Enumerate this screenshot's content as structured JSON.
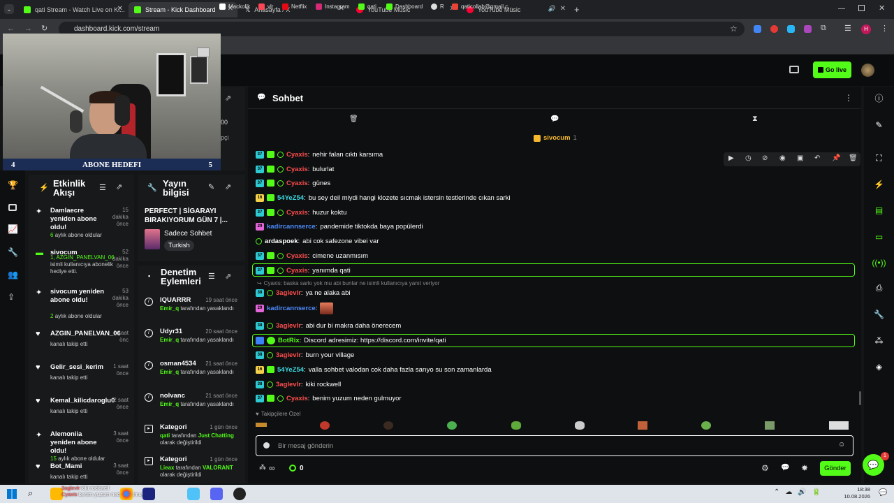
{
  "browser": {
    "tabs": [
      {
        "title": "qati Stream - Watch Live on Ki...",
        "color": "#53fc18"
      },
      {
        "title": "Stream - Kick Dashboard",
        "color": "#53fc18"
      },
      {
        "title": "Anasayfa / X",
        "color": "#ffffff"
      },
      {
        "title": "YouTube Music",
        "color": "#ff0033"
      },
      {
        "title": "YouTube Music",
        "color": "#ff0033"
      }
    ],
    "url": "dashboard.kick.com/stream",
    "bookmarks": [
      {
        "label": "Mackolik",
        "color": "#ffffff"
      },
      {
        "label": "vlr",
        "color": "#ff4655"
      },
      {
        "label": "Netflix",
        "color": "#e50914"
      },
      {
        "label": "Instagram",
        "color": "#d62976"
      },
      {
        "label": "qati",
        "color": "#53fc18"
      },
      {
        "label": "Dashboard",
        "color": "#53fc18"
      },
      {
        "label": "R",
        "color": "#ffffff"
      },
      {
        "label": "qaticollab@gmail.c...",
        "color": "#ea4335"
      }
    ],
    "profile_initial": "H"
  },
  "header": {
    "go_live": "Go live"
  },
  "overlay": {
    "abone_left": "4",
    "abone_title": "ABONE HEDEFI",
    "abone_right": "5"
  },
  "partial": {
    "text1": "00",
    "text2": "pçi"
  },
  "activity": {
    "title1": "Etkinlik",
    "title2": "Akışı",
    "items": [
      {
        "name": "Damlaecre yeniden abone oldu!",
        "time": "15 dakika önce",
        "detail_num": "6",
        "detail": "aylık abone oldular",
        "icon": "sparkle"
      },
      {
        "name": "sivocum",
        "time": "52 dakika önce",
        "detail_num": "1, AZGIN_PANELVAN_06",
        "detail": "isimli kullanıcıya abonelik hediye etti.",
        "icon": "gift"
      },
      {
        "name": "sivocum yeniden abone oldu!",
        "time": "53 dakika önce",
        "detail_num": "2",
        "detail": "aylık abone oldular",
        "icon": "sparkle"
      },
      {
        "name": "AZGIN_PANELVAN_06",
        "time": "1 saat önc",
        "detail_num": "",
        "detail": "kanalı takip etti",
        "icon": "heart"
      },
      {
        "name": "Gelir_sesi_kerim",
        "time": "1 saat önce",
        "detail_num": "",
        "detail": "kanalı takip etti",
        "icon": "heart"
      },
      {
        "name": "Kemal_kilicdaroglu0",
        "time": "2 saat önce",
        "detail_num": "",
        "detail": "kanalı takip etti",
        "icon": "heart"
      },
      {
        "name": "Alemoniia yeniden abone oldu!",
        "time": "3 saat önce",
        "detail_num": "15",
        "detail": "aylık abone oldular",
        "icon": "sparkle"
      },
      {
        "name": "Bot_Mami",
        "time": "3 saat önce",
        "detail_num": "",
        "detail": "kanalı takip etti",
        "icon": "heart"
      }
    ]
  },
  "streaminfo": {
    "title1": "Yayın",
    "title2": "bilgisi",
    "stream_title": "PERFECT | SİGARAYI BIRAKIYORUM GÜN 7 |...",
    "category": "Sadece Sohbet",
    "language": "Turkish"
  },
  "moderation": {
    "title1": "Denetim",
    "title2": "Eylemleri",
    "items": [
      {
        "name": "IQUARRR",
        "time": "19 saat önce",
        "by": "Emir_q",
        "action": "tarafından yasaklandı",
        "icon": "ban"
      },
      {
        "name": "Udyr31",
        "time": "20 saat önce",
        "by": "Emir_q",
        "action": "tarafından yasaklandı",
        "icon": "ban"
      },
      {
        "name": "osman4534",
        "time": "21 saat önce",
        "by": "Emir_q",
        "action": "tarafından yasaklandı",
        "icon": "ban"
      },
      {
        "name": "nolvanc",
        "time": "21 saat önce",
        "by": "Emir_q",
        "action": "tarafından yasaklandı",
        "icon": "ban"
      },
      {
        "name": "Kategori",
        "time": "1 gün önce",
        "by": "qati",
        "action": "tarafından",
        "target": "Just Chatting",
        "suffix": "olarak değiştirildi",
        "icon": "cat"
      },
      {
        "name": "Kategori",
        "time": "1 gün önce",
        "by": "Lieax",
        "action": "tarafından",
        "target": "VALORANT",
        "suffix": "olarak değiştirildi",
        "icon": "cat"
      }
    ]
  },
  "chat": {
    "title": "Sohbet",
    "pinned_user": "sivocum",
    "pinned_count": "1",
    "messages": [
      {
        "badge": "37",
        "sub": true,
        "ring": true,
        "user": "Cyaxis",
        "ucolor": "u-red",
        "text": "nehir falan cıktı karsıma"
      },
      {
        "badge": "37",
        "sub": true,
        "ring": true,
        "user": "Cyaxis",
        "ucolor": "u-red",
        "text": "bulurlat"
      },
      {
        "badge": "37",
        "sub": true,
        "ring": true,
        "user": "Cyaxis",
        "ucolor": "u-red",
        "text": "günes"
      },
      {
        "badge": "16",
        "sub": true,
        "ring": false,
        "user": "54YeZ54",
        "ucolor": "u-cyan",
        "text": "bu sey deil miydi hangi klozete sıcmak istersin testlerinde cıkan sarki"
      },
      {
        "badge": "37",
        "sub": true,
        "ring": true,
        "user": "Cyaxis",
        "ucolor": "u-red",
        "text": "huzur koktu"
      },
      {
        "badge": "29",
        "sub": false,
        "ring": false,
        "user": "kadircannserce",
        "ucolor": "u-blue",
        "text": "pandemide tiktokda baya popülerdi"
      },
      {
        "badge": "",
        "sub": false,
        "ring": true,
        "user": "ardaspoek",
        "ucolor": "u-white",
        "text": "abi cok safezone vibei var"
      },
      {
        "badge": "37",
        "sub": true,
        "ring": true,
        "user": "Cyaxis",
        "ucolor": "u-red",
        "text": "cimene uzanmısım"
      },
      {
        "badge": "37",
        "sub": true,
        "ring": true,
        "user": "Cyaxis",
        "ucolor": "u-red",
        "text": "yanımda qati"
      },
      {
        "badge": "38",
        "sub": false,
        "ring": true,
        "user": "3aglevlr",
        "ucolor": "u-red",
        "text": "ya ne alaka abi"
      },
      {
        "badge": "29",
        "sub": false,
        "ring": false,
        "user": "kadircannserce",
        "ucolor": "u-blue",
        "text": ""
      },
      {
        "badge": "38",
        "sub": false,
        "ring": true,
        "user": "3aglevlr",
        "ucolor": "u-red",
        "text": "abi dur bi makra daha önerecem"
      },
      {
        "badge": "",
        "sub": false,
        "ring": false,
        "user": "BotRix",
        "ucolor": "u-green",
        "text": "Discord adresimiz: https://discord.com/invite/qati"
      },
      {
        "badge": "38",
        "sub": false,
        "ring": true,
        "user": "3aglevlr",
        "ucolor": "u-red",
        "text": "burn your village"
      },
      {
        "badge": "16",
        "sub": true,
        "ring": false,
        "user": "54YeZ54",
        "ucolor": "u-cyan",
        "text": "valla sohbet valodan cok daha fazla sarıyo su son zamanlarda"
      },
      {
        "badge": "38",
        "sub": false,
        "ring": true,
        "user": "3aglevlr",
        "ucolor": "u-red",
        "text": "kiki rockwell"
      },
      {
        "badge": "37",
        "sub": true,
        "ring": true,
        "user": "Cyaxis",
        "ucolor": "u-red",
        "text": "benim yuzum neden gulmuyor"
      }
    ],
    "reply_note": "Cyaxis: baska sarkı yok mu abi bunlar ne isimli kullanıcıya yanıt veriyor",
    "followers_only": "Takipçilere Özel",
    "input_placeholder": "Bir mesaj gönderin",
    "infinite": "∞",
    "points": "0",
    "send": "Gönder"
  },
  "taskbar": {
    "preview_user": "3aglevlr",
    "preview_text": "kiki rockwell",
    "preview_user2": "Cyaxis",
    "preview_text2": "benim yuzum neden gulmuyor",
    "time": "18:38",
    "date": "10.08.2026"
  },
  "notify_count": "1"
}
